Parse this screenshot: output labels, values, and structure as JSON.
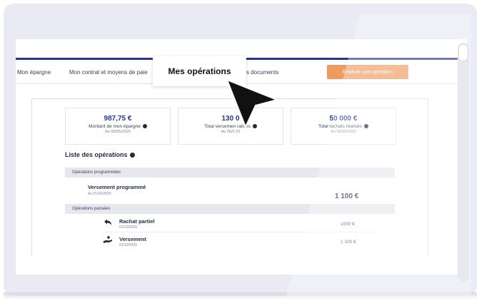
{
  "nav": {
    "items": [
      "Mon épargne",
      "Mon contrat et moyens de paie",
      "s documents"
    ],
    "cta_label": "Réaliser une opération"
  },
  "tooltip": {
    "text": "Mes opérations"
  },
  "cards": [
    {
      "amount": "987,75 €",
      "label": "Montant de mon épargne",
      "date": "Au 06/05/2020"
    },
    {
      "amount": "130 0",
      "label": "Total versemen      ralisés",
      "date": "Au 06/0   20"
    },
    {
      "amount": "50 000 €",
      "label": "Total rachats réalisés",
      "date": "Au 06/05/2020"
    }
  ],
  "operations": {
    "title": "Liste des opérations",
    "scheduled_label": "Opérations programmées",
    "scheduled": [
      {
        "title": "Versement programmé",
        "date": "Au 01/10/2020",
        "amount": "1 100 €"
      }
    ],
    "past_label": "Opérations passées",
    "past": [
      {
        "title": "Rachat partiel",
        "date": "01/10/2020",
        "amount": "1000 €",
        "icon": "undo-arrow-icon"
      },
      {
        "title": "Versement",
        "date": "01/10/2020",
        "amount": "1 100 €",
        "icon": "hand-deposit-icon"
      }
    ]
  },
  "colors": {
    "accent": "#24368f",
    "cta": "#ef9a5e"
  }
}
